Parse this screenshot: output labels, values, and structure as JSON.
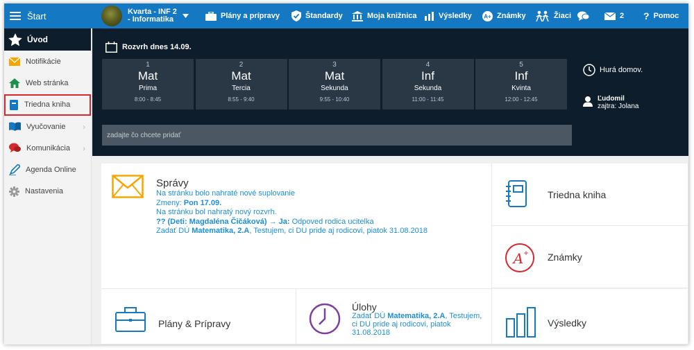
{
  "topbar": {
    "menu_label": "Štart",
    "school_line1": "Kvarta - INF 2",
    "school_line2": "- Informatika",
    "nav": [
      {
        "label": "Plány a prípravy",
        "icon": "briefcase-icon"
      },
      {
        "label": "Štandardy",
        "icon": "shield-check-icon"
      },
      {
        "label": "Moja knižnica",
        "icon": "library-icon"
      },
      {
        "label": "Výsledky",
        "icon": "bar-chart-icon"
      },
      {
        "label": "Známky",
        "icon": "grade-icon"
      },
      {
        "label": "Žiaci",
        "icon": "students-icon"
      }
    ],
    "chat_icon": "chat-icon",
    "mail_count": "2",
    "help_label": "Pomoc"
  },
  "sidebar": {
    "header_label": "Úvod",
    "items": [
      {
        "label": "Notifikácie",
        "icon": "envelope-icon",
        "color": "#f7a600"
      },
      {
        "label": "Web stránka",
        "icon": "home-icon",
        "color": "#1f8f4c"
      },
      {
        "label": "Triedna kniha",
        "icon": "notebook-icon",
        "color": "#1479c2",
        "highlighted": true
      },
      {
        "label": "Vyučovanie",
        "icon": "book-icon",
        "color": "#1479c2",
        "submenu": true
      },
      {
        "label": "Komunikácia",
        "icon": "chat-bubbles-icon",
        "color": "#d7282d",
        "submenu": true
      },
      {
        "label": "Agenda Online",
        "icon": "pen-icon",
        "color": "#1479c2"
      },
      {
        "label": "Nastavenia",
        "icon": "gear-icon",
        "color": "#888888"
      }
    ]
  },
  "schedule": {
    "title": "Rozvrh dnes 14.09.",
    "periods": [
      {
        "num": "1",
        "subject": "Mat",
        "class": "Prima",
        "time": "8:00 - 8:45"
      },
      {
        "num": "2",
        "subject": "Mat",
        "class": "Tercia",
        "time": "8:55 - 9:40"
      },
      {
        "num": "3",
        "subject": "Mat",
        "class": "Sekunda",
        "time": "9:55 - 10:40"
      },
      {
        "num": "4",
        "subject": "Inf",
        "class": "Sekunda",
        "time": "11:00 - 11:45"
      },
      {
        "num": "5",
        "subject": "Inf",
        "class": "Kvinta",
        "time": "12:00 - 12:45"
      }
    ],
    "home_text": "Hurá domov.",
    "teacher_name": "Ľudomil",
    "teacher_tomorrow": "zajtra: Jolana",
    "input_placeholder": "zadajte čo chcete pridať"
  },
  "news": {
    "title": "Správy",
    "line1": "Na stránku bolo nahraté nové suplovanie",
    "line2_prefix": "Zmeny: ",
    "line2_bold": "Pon 17.09.",
    "line3": "Na stránku bol nahratý nový rozvrh.",
    "line4_bold": "?? (Deti: Magdaléna Čičáková) → Ja:",
    "line4_rest": " Odpoved rodica ucitelka",
    "line5_prefix": "Zadať DÚ ",
    "line5_bold": "Matematika, 2.A",
    "line5_rest": ", Testujem, ci DU pride aj rodicovi, piatok 31.08.2018"
  },
  "cards": {
    "triedna_kniha": "Triedna kniha",
    "znamky": "Známky",
    "vysledky": "Výsledky",
    "plany": "Plány & Prípravy",
    "ulohy_title": "Úlohy",
    "ulohy_prefix": "Zadať DÚ ",
    "ulohy_bold": "Matematika, 2.A",
    "ulohy_rest": ", Testujem, ci DU pride aj rodicovi, piatok 31.08.2018"
  },
  "colors": {
    "topbar": "#1479c2",
    "dark_panel": "#0e1d2c",
    "period_tile": "#2a3846",
    "link_blue": "#1a8fd6",
    "highlight_red": "#d7282d",
    "mail_orange": "#f7a600",
    "ulohy_purple": "#7b3fa0"
  }
}
